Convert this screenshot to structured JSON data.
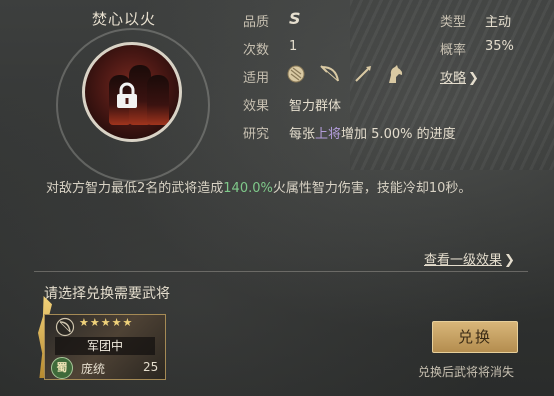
{
  "skill": {
    "name": "焚心以火",
    "quality_label": "品质",
    "quality_value": "S",
    "type_label": "类型",
    "type_value": "主动",
    "count_label": "次数",
    "count_value": "1",
    "rate_label": "概率",
    "rate_value": "35%",
    "apply_label": "适用",
    "strategy_link": "攻略",
    "effect_label": "效果",
    "effect_value": "智力群体",
    "research_label": "研究",
    "research_pre": "每张",
    "research_hl": "上将",
    "research_post": "增加 5.00% 的进度"
  },
  "description": {
    "part1": "对敌方智力最低2名的武将造成",
    "highlight": "140.0%",
    "part2": "火属性智力伤害，技能冷却10秒。"
  },
  "view_level1_link": "查看一级效果",
  "select_title": "请选择兑换需要武将",
  "general_card": {
    "stars": 5,
    "troop": "军团中",
    "faction": "蜀",
    "name": "庞统",
    "level": "25"
  },
  "redeem_button": "兑换",
  "redeem_note": "兑换后武将将消失",
  "colors": {
    "accent_gold": "#d8b679",
    "highlight_green": "#7fc98a",
    "highlight_purple": "#b39ddb"
  }
}
